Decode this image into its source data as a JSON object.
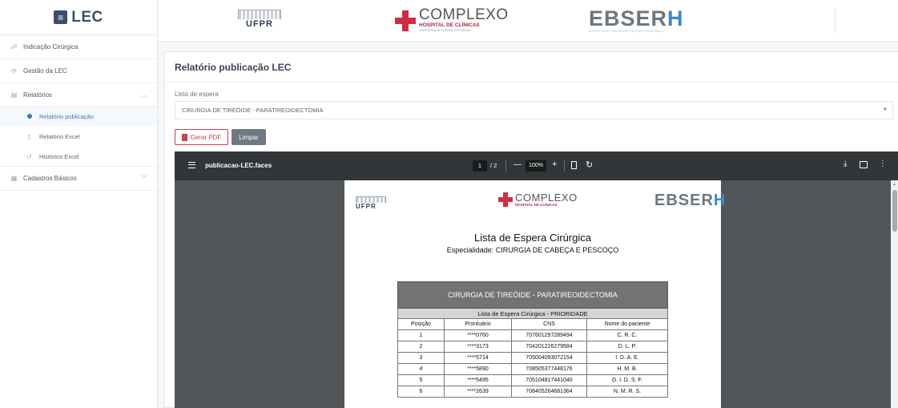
{
  "sidebar": {
    "brand": "LEC",
    "brand_mark": "≡",
    "items": [
      {
        "label": "Indicação Cirúrgica",
        "icon": "☍"
      },
      {
        "label": "Gestão da LEC",
        "icon": "⟳"
      },
      {
        "label": "Relatórios",
        "icon": "▤"
      },
      {
        "label": "Cadastros Básicos",
        "icon": "▦"
      }
    ],
    "sub_items": [
      {
        "label": "Relatório publicação"
      },
      {
        "label": "Relatório Excel",
        "icon": "▯"
      },
      {
        "label": "Histórico Excel",
        "icon": "↺"
      }
    ]
  },
  "header": {
    "ufpr": "UFPR",
    "complexo_word": "COMPLEXO",
    "complexo_sub": "HOSPITAL DE CLÍNICAS",
    "complexo_sub2": "UNIVERSIDADE FEDERAL DO PARANÁ",
    "ebserh_main": "EBSER",
    "ebserh_h": "H",
    "ebserh_sub": "HOSPITAIS UNIVERSITÁRIOS FEDERAIS"
  },
  "main": {
    "title": "Relatório publicação LEC",
    "list_label": "Lista de espera",
    "list_value": "CIRURGIA DE TIREÓIDE - PARATIREOIDECTOMIA",
    "btn_pdf": "Gerar PDF",
    "btn_clear": "Limpar"
  },
  "viewer": {
    "filename": "publicacao-LEC.faces",
    "page_current": "1",
    "page_total": "/ 2",
    "zoom": "100%",
    "minus": "—",
    "plus": "+",
    "rotate": "↻",
    "download": "⤓",
    "more": "⋮"
  },
  "document": {
    "title": "Lista de Espera Cirúrgica",
    "subtitle": "Especialidade: CIRURGIA DE CABEÇA E PESCOÇO",
    "table_title": "CIRURGIA DE TIREÓIDE - PARATIREOIDECTOMIA",
    "table_subtitle": "Lista de Espera Cirúrgica - PRIORIDADE",
    "columns": [
      "Posição",
      "Prontuário",
      "CNS",
      "Nome do paciente"
    ],
    "rows": [
      [
        "1",
        "****0760",
        "707601297289494",
        "C. R. C."
      ],
      [
        "2",
        "****3173",
        "704201226279584",
        "D. L. P."
      ],
      [
        "3",
        "****5714",
        "705004093072154",
        "I. D. A. E."
      ],
      [
        "4",
        "****5890",
        "708505377448176",
        "H. M. B."
      ],
      [
        "5",
        "****5495",
        "705104817441040",
        "D. I. D. S. F."
      ],
      [
        "6",
        "****2639",
        "708405264681364",
        "N. M. R. S."
      ]
    ]
  }
}
